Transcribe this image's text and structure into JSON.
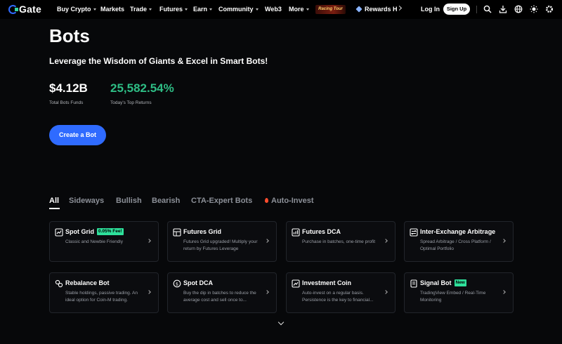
{
  "nav": {
    "logo": "Gate",
    "items": [
      {
        "label": "Buy Crypto",
        "dropdown": true
      },
      {
        "label": "Markets",
        "dropdown": false
      },
      {
        "label": "Trade",
        "dropdown": true
      },
      {
        "label": "Futures",
        "dropdown": true
      },
      {
        "label": "Earn",
        "dropdown": true
      },
      {
        "label": "Community",
        "dropdown": true
      },
      {
        "label": "Web3",
        "dropdown": false
      },
      {
        "label": "More",
        "dropdown": true
      }
    ],
    "promo_banner": "Racing Tour",
    "rewards_label": "Rewards H",
    "login_label": "Log In",
    "signup_label": "Sign Up",
    "icons": [
      "search-icon",
      "download-icon",
      "globe-icon",
      "theme-icon",
      "settings-icon"
    ]
  },
  "hero": {
    "title": "Bots",
    "subtitle": "Leverage the Wisdom of Giants & Excel in Smart Bots!",
    "stats": [
      {
        "value": "$4.12B",
        "label": "Total Bots Funds",
        "color": "#ffffff"
      },
      {
        "value": "25,582.54%",
        "label": "Today's Top Returns",
        "color": "#2ebd85"
      }
    ],
    "create_button": "Create a Bot"
  },
  "tabs": [
    {
      "label": "All",
      "active": true
    },
    {
      "label": "Sideways",
      "active": false
    },
    {
      "label": "Bullish",
      "active": false
    },
    {
      "label": "Bearish",
      "active": false
    },
    {
      "label": "CTA-Expert Bots",
      "active": false
    },
    {
      "label": "Auto-Invest",
      "active": false,
      "icon": "flame-icon"
    }
  ],
  "cards": [
    {
      "title": "Spot Grid",
      "badge": "0.05% Fee!",
      "desc": "Classic and Newbie Friendly",
      "icon": "chart-icon"
    },
    {
      "title": "Futures Grid",
      "badge": "",
      "desc": "Futures Grid upgraded! Multiply your return by Futures Leverage",
      "icon": "futures-grid-icon"
    },
    {
      "title": "Futures DCA",
      "badge": "",
      "desc": "Purchase in batches, one-time profit",
      "icon": "futures-dca-icon"
    },
    {
      "title": "Inter-Exchange Arbitrage",
      "badge": "",
      "desc": "Spread Arbitrage / Cross Platform / Optimal Portfolio",
      "icon": "arbitrage-icon"
    },
    {
      "title": "Rebalance Bot",
      "badge": "",
      "desc": "Stable holdings, passive trading. An ideal option for Coin-M trading.",
      "icon": "rebalance-icon"
    },
    {
      "title": "Spot DCA",
      "badge": "",
      "desc": "Buy the dip in batches to reduce the average cost and sell once to...",
      "icon": "spot-dca-icon"
    },
    {
      "title": "Investment Coin",
      "badge": "",
      "desc": "Auto-invest on a regular basis. Persistence is the key to financial...",
      "icon": "investment-coin-icon"
    },
    {
      "title": "Signal Bot",
      "badge": "New",
      "desc": "TradingView Embed / Real-Time Monitoring",
      "icon": "signal-bot-icon"
    }
  ],
  "colors": {
    "accent": "#2f6bff",
    "positive": "#2ebd85",
    "badge": "#2ee09b",
    "background": "#07080a"
  }
}
